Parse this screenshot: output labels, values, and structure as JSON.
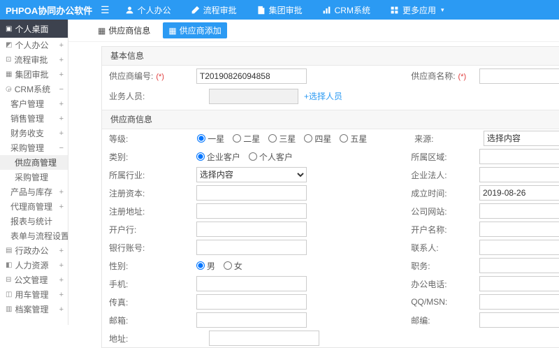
{
  "topbar": {
    "logo": "PHPOA协同办公软件",
    "hamburger": "☰",
    "caret": "▾",
    "nav": [
      {
        "label": "个人办公"
      },
      {
        "label": "流程审批"
      },
      {
        "label": "集团审批"
      },
      {
        "label": "CRM系统"
      },
      {
        "label": "更多应用"
      }
    ]
  },
  "colors": {
    "accent_blue": "#2b9af3",
    "sidebar_dark": "#3d424e",
    "required_red": "#e03c3c"
  },
  "sidebar": {
    "items": [
      {
        "label": "个人桌面",
        "glyph": "▣",
        "expand": ""
      },
      {
        "label": "个人办公",
        "glyph": "◩",
        "expand": "+"
      },
      {
        "label": "流程审批",
        "glyph": "⊡",
        "expand": "+"
      },
      {
        "label": "集团审批",
        "glyph": "▦",
        "expand": "+"
      },
      {
        "label": "CRM系统",
        "glyph": "◶",
        "expand": "−"
      },
      {
        "label": "客户管理",
        "glyph": "",
        "expand": "+"
      },
      {
        "label": "销售管理",
        "glyph": "",
        "expand": "+"
      },
      {
        "label": "财务收支",
        "glyph": "",
        "expand": "+"
      },
      {
        "label": "采购管理",
        "glyph": "",
        "expand": "−"
      },
      {
        "label": "供应商管理",
        "glyph": "",
        "expand": ""
      },
      {
        "label": "采购管理",
        "glyph": "",
        "expand": ""
      },
      {
        "label": "产品与库存",
        "glyph": "",
        "expand": "+"
      },
      {
        "label": "代理商管理",
        "glyph": "",
        "expand": "+"
      },
      {
        "label": "报表与统计",
        "glyph": "",
        "expand": ""
      },
      {
        "label": "表单与流程设置",
        "glyph": "",
        "expand": "+"
      },
      {
        "label": "行政办公",
        "glyph": "▤",
        "expand": "+"
      },
      {
        "label": "人力资源",
        "glyph": "◧",
        "expand": "+"
      },
      {
        "label": "公文管理",
        "glyph": "⊟",
        "expand": "+"
      },
      {
        "label": "用车管理",
        "glyph": "◫",
        "expand": "+"
      },
      {
        "label": "档案管理",
        "glyph": "▥",
        "expand": "+"
      }
    ]
  },
  "tabs": {
    "info": {
      "label": "供应商信息",
      "glyph": "▦"
    },
    "add": {
      "label": "供应商添加",
      "glyph": "▦"
    }
  },
  "form": {
    "required_mark": "(*)",
    "sections": {
      "basic": {
        "title": "基本信息"
      },
      "supplier": {
        "title": "供应商信息"
      }
    },
    "fields": {
      "supplier_no": {
        "label": "供应商编号:",
        "value": "T20190826094858"
      },
      "supplier_name": {
        "label": "供应商名称:",
        "value": ""
      },
      "staff": {
        "label": "业务人员:",
        "value": "",
        "link": "+选择人员"
      },
      "level": {
        "label": "等级:",
        "options": [
          "一星",
          "二星",
          "三星",
          "四星",
          "五星"
        ],
        "selected": "一星"
      },
      "source": {
        "label": "来源:",
        "value": "选择内容"
      },
      "category": {
        "label": "类别:",
        "options": [
          "企业客户",
          "个人客户"
        ],
        "selected": "企业客户"
      },
      "region": {
        "label": "所属区域:",
        "value": ""
      },
      "industry": {
        "label": "所属行业:",
        "value": "选择内容"
      },
      "legal_person": {
        "label": "企业法人:",
        "value": ""
      },
      "reg_capital": {
        "label": "注册资本:",
        "value": ""
      },
      "founded": {
        "label": "成立时间:",
        "value": "2019-08-26"
      },
      "reg_address": {
        "label": "注册地址:",
        "value": ""
      },
      "website": {
        "label": "公司网站:",
        "value": ""
      },
      "bank": {
        "label": "开户行:",
        "value": ""
      },
      "account_name": {
        "label": "开户名称:",
        "value": ""
      },
      "bank_account": {
        "label": "银行账号:",
        "value": ""
      },
      "contact": {
        "label": "联系人:",
        "value": ""
      },
      "gender": {
        "label": "性别:",
        "options": [
          "男",
          "女"
        ],
        "selected": "男"
      },
      "position": {
        "label": "职务:",
        "value": ""
      },
      "mobile": {
        "label": "手机:",
        "value": ""
      },
      "office_phone": {
        "label": "办公电话:",
        "value": ""
      },
      "fax": {
        "label": "传真:",
        "value": ""
      },
      "qq": {
        "label": "QQ/MSN:",
        "value": ""
      },
      "email": {
        "label": "邮箱:",
        "value": ""
      },
      "zip": {
        "label": "邮编:",
        "value": ""
      },
      "address": {
        "label": "地址:",
        "value": ""
      }
    }
  }
}
